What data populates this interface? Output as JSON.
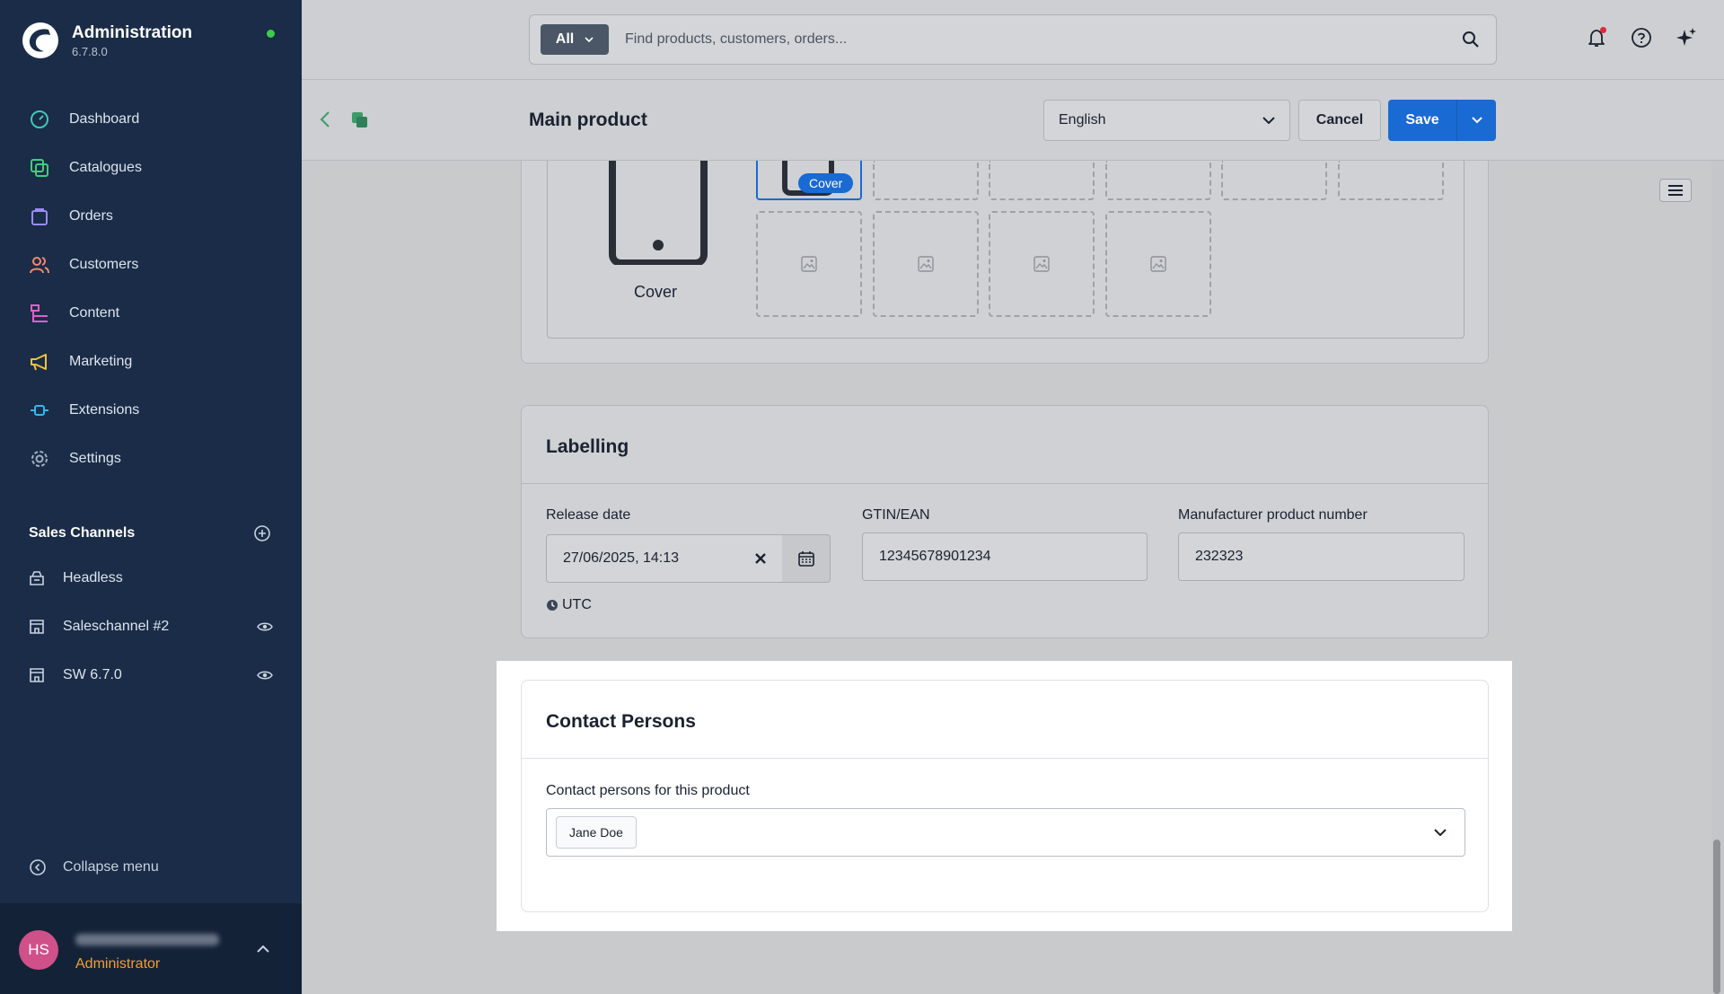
{
  "brand": {
    "title": "Administration",
    "version": "6.7.8.0"
  },
  "nav": [
    {
      "label": "Dashboard",
      "icon": "dashboard-icon",
      "color": "#3ec9b4"
    },
    {
      "label": "Catalogues",
      "icon": "catalogues-icon",
      "color": "#3dcf7a"
    },
    {
      "label": "Orders",
      "icon": "orders-icon",
      "color": "#9b8cf0"
    },
    {
      "label": "Customers",
      "icon": "customers-icon",
      "color": "#f08a6e"
    },
    {
      "label": "Content",
      "icon": "content-icon",
      "color": "#e45ec8"
    },
    {
      "label": "Marketing",
      "icon": "marketing-icon",
      "color": "#f2c23a"
    },
    {
      "label": "Extensions",
      "icon": "extensions-icon",
      "color": "#3ab4f2"
    },
    {
      "label": "Settings",
      "icon": "settings-icon",
      "color": "#a5b0c0"
    }
  ],
  "sales_channels": {
    "title": "Sales Channels",
    "items": [
      {
        "label": "Headless"
      },
      {
        "label": "Saleschannel #2"
      },
      {
        "label": "SW 6.7.0"
      }
    ]
  },
  "collapse_label": "Collapse menu",
  "user": {
    "initials": "HS",
    "role": "Administrator"
  },
  "search": {
    "type": "All",
    "placeholder": "Find products, customers, orders..."
  },
  "smartbar": {
    "title": "Main product",
    "language": "English",
    "cancel_label": "Cancel",
    "save_label": "Save"
  },
  "media": {
    "cover_label": "Cover",
    "cover_badge": "Cover"
  },
  "labelling": {
    "title": "Labelling",
    "release_date_label": "Release date",
    "release_date_value": "27/06/2025, 14:13",
    "timezone": "UTC",
    "gtin_label": "GTIN/EAN",
    "gtin_value": "12345678901234",
    "mpn_label": "Manufacturer product number",
    "mpn_value": "232323"
  },
  "contact": {
    "title": "Contact Persons",
    "field_label": "Contact persons for this product",
    "selected": [
      "Jane Doe"
    ]
  },
  "colors": {
    "sidebar": "#1a2c47",
    "primary": "#1a6ad4",
    "role": "#f0a030"
  }
}
